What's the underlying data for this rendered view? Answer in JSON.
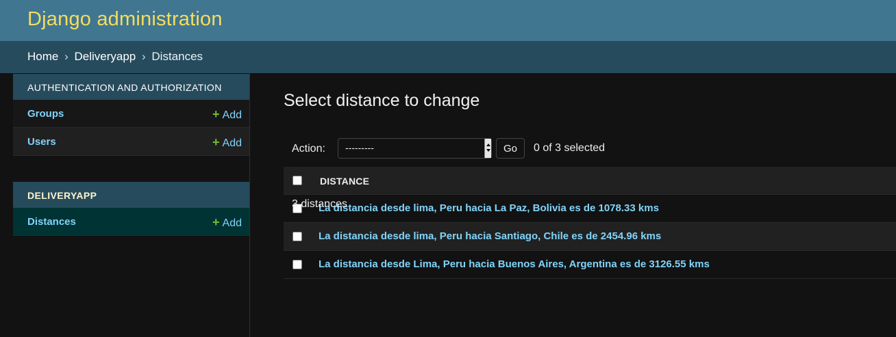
{
  "header": {
    "branding": "Django administration"
  },
  "breadcrumbs": {
    "home": "Home",
    "separator": "›",
    "app": "Deliveryapp",
    "current": "Distances"
  },
  "sidebar": {
    "modules": [
      {
        "caption": "Authentication and Authorization",
        "models": [
          {
            "name": "Groups",
            "add_label": "Add"
          },
          {
            "name": "Users",
            "add_label": "Add"
          }
        ]
      },
      {
        "caption": "Deliveryapp",
        "models": [
          {
            "name": "Distances",
            "add_label": "Add"
          }
        ]
      }
    ],
    "add_icon": "+"
  },
  "main": {
    "title": "Select distance to change",
    "actions": {
      "label": "Action:",
      "select_value": "---------",
      "go_label": "Go",
      "selected_count": "0 of 3 selected"
    },
    "table": {
      "column_header": "DISTANCE",
      "rows": [
        "La distancia desde lima, Peru hacia La Paz, Bolivia es de 1078.33 kms",
        "La distancia desde lima, Peru hacia Santiago, Chile es de 2454.96 kms",
        "La distancia desde Lima, Peru hacia Buenos Aires, Argentina es de 3126.55 kms"
      ]
    },
    "paginator": "3 distances"
  },
  "colors": {
    "header_bg": "#417690",
    "branding": "#f5dd5d",
    "breadcrumbs_bg": "#264b5d",
    "link": "#81d4fa",
    "add_plus": "#70bf2b",
    "current_model_bg": "#003333"
  }
}
